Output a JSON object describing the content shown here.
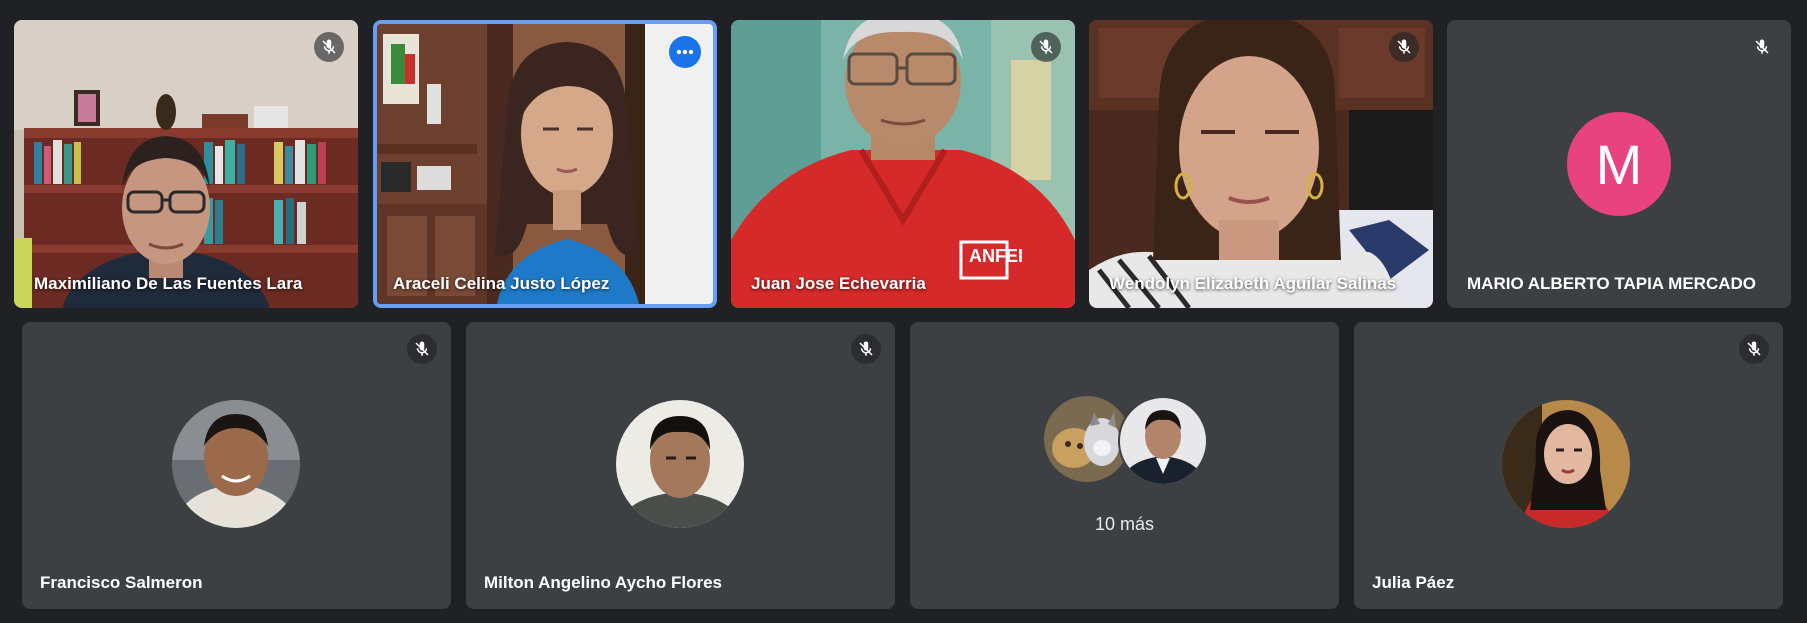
{
  "participants_top": [
    {
      "name": "Maximiliano De Las Fuentes Lara",
      "muted": true
    },
    {
      "name": "Araceli Celina Justo López",
      "muted": false,
      "active_speaker": true
    },
    {
      "name": "Juan Jose Echevarria",
      "muted": true
    },
    {
      "name": "Wendolyn Elizabeth Aguilar Salinas",
      "muted": true
    },
    {
      "name": "MARIO ALBERTO TAPIA MERCADO",
      "muted": true,
      "avatar_letter": "M",
      "avatar_color": "#e8437f"
    }
  ],
  "participants_bottom": [
    {
      "name": "Francisco Salmeron",
      "muted": true
    },
    {
      "name": "Milton Angelino Aycho Flores",
      "muted": true
    },
    {
      "overflow_label": "10 más"
    },
    {
      "name": "Julia Páez",
      "muted": true
    }
  ],
  "shirt_logo_text": "ANFEI",
  "colors": {
    "background": "#202124",
    "tile": "#3c4043",
    "active_border": "#669df6",
    "more_button": "#1a73e8"
  },
  "icons": {
    "mute": "mic-off-icon",
    "more": "more-options-icon"
  }
}
